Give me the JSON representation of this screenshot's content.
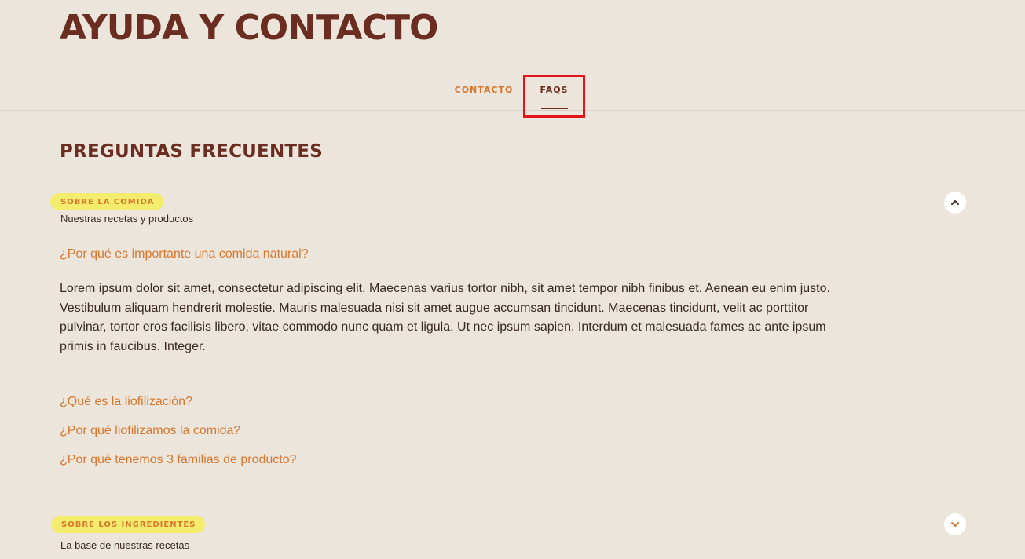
{
  "header": {
    "title": "AYUDA Y CONTACTO"
  },
  "tabs": [
    {
      "label": "CONTACTO",
      "active": false
    },
    {
      "label": "FAQS",
      "active": true
    }
  ],
  "faq": {
    "title": "PREGUNTAS FRECUENTES",
    "categories": [
      {
        "badge": "SOBRE LA COMIDA",
        "subtitle": "Nuestras recetas y productos",
        "expanded": true,
        "toggle_icon": "chevron-up-icon",
        "questions": [
          {
            "question": "¿Por qué es importante una comida natural?",
            "answer": "Lorem ipsum dolor sit amet, consectetur adipiscing elit. Maecenas varius tortor nibh, sit amet tempor nibh finibus et. Aenean eu enim justo. Vestibulum aliquam hendrerit molestie. Mauris malesuada nisi sit amet augue accumsan tincidunt. Maecenas tincidunt, velit ac porttitor pulvinar, tortor eros facilisis libero, vitae commodo nunc quam et ligula. Ut nec ipsum sapien. Interdum et malesuada fames ac ante ipsum primis in faucibus. Integer."
          },
          {
            "question": "¿Qué es la liofilización?"
          },
          {
            "question": "¿Por qué liofilizamos la comida?"
          },
          {
            "question": "¿Por qué tenemos 3 familias de producto?"
          }
        ]
      },
      {
        "badge": "SOBRE LOS INGREDIENTES",
        "subtitle": "La base de nuestras recetas",
        "expanded": false,
        "toggle_icon": "chevron-down-icon"
      }
    ]
  },
  "colors": {
    "background": "#ebe5dc",
    "brand_brown": "#6b2d1f",
    "accent_orange": "#d9772d",
    "badge_yellow": "#f4ec6d",
    "highlight_red": "#e3141b"
  }
}
